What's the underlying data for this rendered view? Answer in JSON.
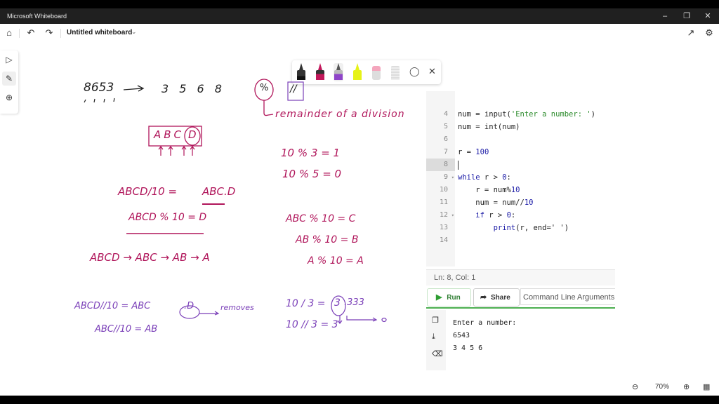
{
  "window": {
    "title": "Microsoft Whiteboard",
    "controls": [
      "minimize",
      "restore",
      "close"
    ]
  },
  "appbar": {
    "home_icon": "home-icon",
    "undo_icon": "undo-icon",
    "redo_icon": "redo-icon",
    "board_title": "Untitled whiteboard",
    "share_icon": "share-icon",
    "settings_icon": "gear-icon"
  },
  "left_tools": [
    "select-icon",
    "pen-icon",
    "add-icon"
  ],
  "pen_toolbar": {
    "pens": [
      {
        "name": "black-pen",
        "color": "#1a1a1a"
      },
      {
        "name": "magenta-pen",
        "color": "#c2185b"
      },
      {
        "name": "purple-pen",
        "color": "#8e44c8",
        "selected": true
      },
      {
        "name": "yellow-highlighter",
        "color": "#e6f218"
      },
      {
        "name": "eraser",
        "color": "#f4a6bd"
      },
      {
        "name": "ruler",
        "color": "#d8d8d8"
      }
    ],
    "lasso_icon": "lasso-icon",
    "close_icon": "close-icon"
  },
  "ink": {
    "n1_left": "8653",
    "n1_right": "3 5 6 8",
    "ops_mod": "%",
    "ops_floor": "//",
    "remainder_note": "remainder of a division",
    "abcd_box": "ABC",
    "abcd_circled": "D",
    "ex1": "10 % 3 = 1",
    "ex2": "10 % 5 = 0",
    "eq1_left": "ABCD/10 = ",
    "eq1_right": "ABC.D",
    "eq2": "ABCD % 10 = D",
    "chain": "ABCD → ABC → AB → A",
    "m1": "ABC % 10 = C",
    "m2": "AB % 10 = B",
    "m3": "A % 10 = A",
    "fd1_left": "ABCD//10 = ABC",
    "fd1_circled": ".D",
    "fd1_note": "removes",
    "fd2": "ABC//10 = AB",
    "div1_left": "10 / 3 =",
    "div1_circled": "3",
    "div1_rest": ".333",
    "div1_arrow_to": "0",
    "div2": "10 // 3 = 3"
  },
  "editor": {
    "lines": [
      {
        "n": "4",
        "code": [
          {
            "t": "num = ",
            "c": ""
          },
          {
            "t": "input",
            "c": ""
          },
          {
            "t": "(",
            "c": ""
          },
          {
            "t": "'Enter a number: '",
            "c": "str"
          },
          {
            "t": ")",
            "c": ""
          }
        ]
      },
      {
        "n": "5",
        "code": [
          {
            "t": "num = int(num)",
            "c": ""
          }
        ]
      },
      {
        "n": "6",
        "code": []
      },
      {
        "n": "7",
        "code": [
          {
            "t": "r = ",
            "c": ""
          },
          {
            "t": "100",
            "c": "num"
          }
        ]
      },
      {
        "n": "8",
        "code": [],
        "current": true
      },
      {
        "n": "9",
        "fold": true,
        "code": [
          {
            "t": "while",
            "c": "kw"
          },
          {
            "t": " r > ",
            "c": ""
          },
          {
            "t": "0",
            "c": "num"
          },
          {
            "t": ":",
            "c": ""
          }
        ]
      },
      {
        "n": "10",
        "code": [
          {
            "t": "    r = num%",
            "c": ""
          },
          {
            "t": "10",
            "c": "num"
          }
        ]
      },
      {
        "n": "11",
        "code": [
          {
            "t": "    num = num//",
            "c": ""
          },
          {
            "t": "10",
            "c": "num"
          }
        ]
      },
      {
        "n": "12",
        "fold": true,
        "code": [
          {
            "t": "    ",
            "c": ""
          },
          {
            "t": "if",
            "c": "kw"
          },
          {
            "t": " r > ",
            "c": ""
          },
          {
            "t": "0",
            "c": "num"
          },
          {
            "t": ":",
            "c": ""
          }
        ]
      },
      {
        "n": "13",
        "code": [
          {
            "t": "        ",
            "c": ""
          },
          {
            "t": "print",
            "c": "kw"
          },
          {
            "t": "(r, end=' ')",
            "c": ""
          }
        ]
      },
      {
        "n": "14",
        "code": []
      }
    ],
    "status": "Ln: 8,  Col: 1",
    "run_label": "Run",
    "share_label": "Share",
    "cla_placeholder": "Command Line Arguments"
  },
  "console": {
    "icons": [
      "copy-icon",
      "download-icon",
      "clear-icon"
    ],
    "output": [
      "Enter a number:",
      "6543",
      "3 4 5 6"
    ]
  },
  "zoom": {
    "level": "70%"
  }
}
